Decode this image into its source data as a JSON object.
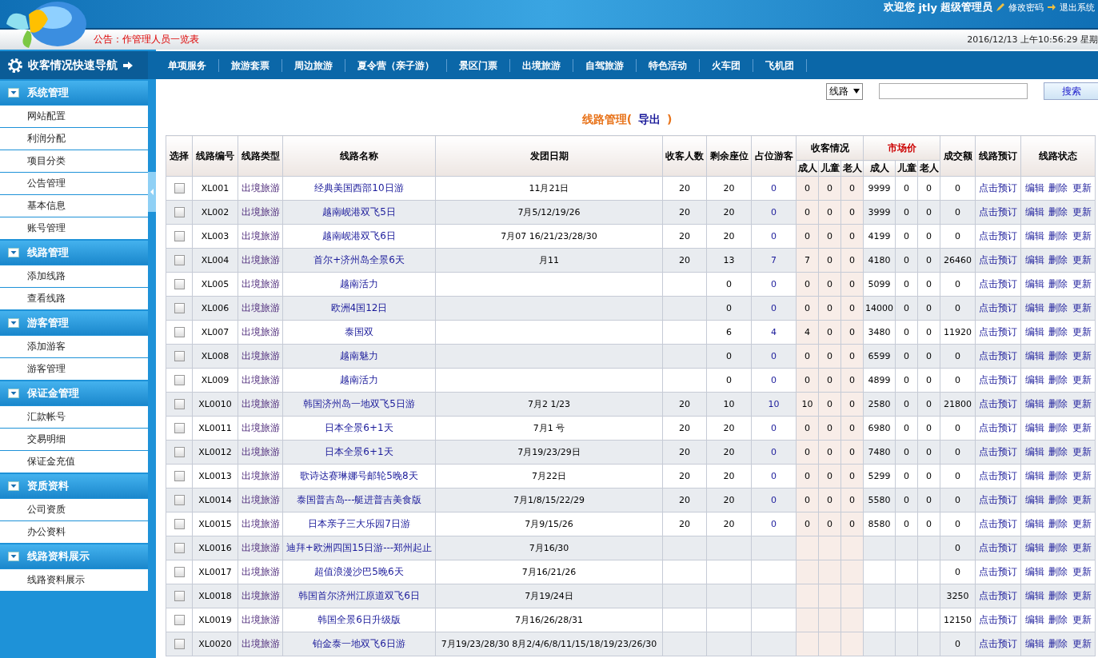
{
  "header": {
    "welcome": "欢迎您",
    "username": "jtly",
    "role": "超级管理员",
    "links": [
      "修改密码",
      "退出系统"
    ]
  },
  "notice": "公告：作管理人员一览表",
  "datetime": "2016/12/13 上午10:56:29 星期",
  "sidebar": {
    "title": "收客情况快速导航",
    "groups": [
      {
        "title": "系统管理",
        "expanded": true,
        "items": [
          "网站配置",
          "利润分配",
          "项目分类",
          "公告管理",
          "基本信息",
          "账号管理"
        ]
      },
      {
        "title": "线路管理",
        "expanded": true,
        "items": [
          "添加线路",
          "查看线路"
        ]
      },
      {
        "title": "游客管理",
        "expanded": true,
        "items": [
          "添加游客",
          "游客管理"
        ]
      },
      {
        "title": "保证金管理",
        "expanded": true,
        "items": [
          "汇款帐号",
          "交易明细",
          "保证金充值"
        ]
      },
      {
        "title": "资质资料",
        "expanded": true,
        "items": [
          "公司资质",
          "办公资料"
        ]
      },
      {
        "title": "线路资料展示",
        "expanded": true,
        "items": [
          "线路资料展示"
        ]
      }
    ]
  },
  "nav_tabs": [
    "单项服务",
    "旅游套票",
    "周边旅游",
    "夏令营（亲子游）",
    "景区门票",
    "出境旅游",
    "自驾旅游",
    "特色活动",
    "火车团",
    "飞机团"
  ],
  "search": {
    "filter": "线路",
    "button": "搜索"
  },
  "heading": {
    "title": "线路管理(",
    "link": "导出",
    "close": ")"
  },
  "table": {
    "columns": [
      {
        "label": "选择"
      },
      {
        "label": "线路编号"
      },
      {
        "label": "线路类型"
      },
      {
        "label": "线路名称"
      },
      {
        "label": "发团日期"
      },
      {
        "label": "收客人数"
      },
      {
        "label": "剩余座位"
      },
      {
        "label": "占位游客"
      },
      {
        "label": "收客情况",
        "highlight": false,
        "sub": [
          "成人",
          "儿童",
          "老人"
        ]
      },
      {
        "label": "市场价",
        "highlight": true,
        "sub": [
          "成人",
          "儿童",
          "老人"
        ]
      },
      {
        "label": "成交额"
      },
      {
        "label": "线路预订"
      },
      {
        "label": "线路状态"
      }
    ],
    "rows": [
      {
        "selected": false,
        "id": "XL001",
        "type": "出境旅游",
        "name": "经典美国西部10日游",
        "date": "11月21日",
        "booked": "20",
        "remaining": "20",
        "occupied": "0",
        "guests": [
          "0",
          "0",
          "0"
        ],
        "prices": [
          "9999",
          "0",
          "0"
        ],
        "amount": "0",
        "book": "点击预订",
        "actions": [
          "编辑",
          "删除",
          "更新"
        ]
      },
      {
        "selected": false,
        "id": "XL002",
        "type": "出境旅游",
        "name": "越南岘港双飞5日",
        "date": "7月5/12/19/26",
        "booked": "20",
        "remaining": "20",
        "occupied": "0",
        "guests": [
          "0",
          "0",
          "0"
        ],
        "prices": [
          "3999",
          "0",
          "0"
        ],
        "amount": "0",
        "book": "点击预订",
        "actions": [
          "编辑",
          "删除",
          "更新"
        ]
      },
      {
        "selected": false,
        "id": "XL003",
        "type": "出境旅游",
        "name": "越南岘港双飞6日",
        "date": "7月07 16/21/23/28/30",
        "booked": "20",
        "remaining": "20",
        "occupied": "0",
        "guests": [
          "0",
          "0",
          "0"
        ],
        "prices": [
          "4199",
          "0",
          "0"
        ],
        "amount": "0",
        "book": "点击预订",
        "actions": [
          "编辑",
          "删除",
          "更新"
        ]
      },
      {
        "selected": false,
        "id": "XL004",
        "type": "出境旅游",
        "name": "首尔+济州岛全景6天",
        "date": "月11",
        "booked": "20",
        "remaining": "13",
        "occupied": "7",
        "guests": [
          "7",
          "0",
          "0"
        ],
        "prices": [
          "4180",
          "0",
          "0"
        ],
        "amount": "26460",
        "book": "点击预订",
        "actions": [
          "编辑",
          "删除",
          "更新"
        ]
      },
      {
        "selected": false,
        "id": "XL005",
        "type": "出境旅游",
        "name": "越南活力",
        "remaining": "0",
        "occupied": "0",
        "guests": [
          "0",
          "0",
          "0"
        ],
        "prices": [
          "5099",
          "0",
          "0"
        ],
        "amount": "0",
        "book": "点击预订",
        "actions": [
          "编辑",
          "删除",
          "更新"
        ]
      },
      {
        "selected": false,
        "id": "XL006",
        "type": "出境旅游",
        "name": "欧洲4国12日",
        "remaining": "0",
        "occupied": "0",
        "guests": [
          "0",
          "0",
          "0"
        ],
        "prices": [
          "14000",
          "0",
          "0"
        ],
        "amount": "0",
        "book": "点击预订",
        "actions": [
          "编辑",
          "删除",
          "更新"
        ]
      },
      {
        "selected": false,
        "id": "XL007",
        "type": "出境旅游",
        "name": "泰国双",
        "remaining": "6",
        "occupied": "4",
        "guests": [
          "4",
          "0",
          "0"
        ],
        "prices": [
          "3480",
          "0",
          "0"
        ],
        "amount": "11920",
        "book": "点击预订",
        "actions": [
          "编辑",
          "删除",
          "更新"
        ]
      },
      {
        "selected": false,
        "id": "XL008",
        "type": "出境旅游",
        "name": "越南魅力",
        "remaining": "0",
        "occupied": "0",
        "guests": [
          "0",
          "0",
          "0"
        ],
        "prices": [
          "6599",
          "0",
          "0"
        ],
        "amount": "0",
        "book": "点击预订",
        "actions": [
          "编辑",
          "删除",
          "更新"
        ]
      },
      {
        "selected": false,
        "id": "XL009",
        "type": "出境旅游",
        "name": "越南活力",
        "remaining": "0",
        "occupied": "0",
        "guests": [
          "0",
          "0",
          "0"
        ],
        "prices": [
          "4899",
          "0",
          "0"
        ],
        "amount": "0",
        "book": "点击预订",
        "actions": [
          "编辑",
          "删除",
          "更新"
        ]
      },
      {
        "selected": false,
        "id": "XL0010",
        "type": "出境旅游",
        "name": "韩国济州岛一地双飞5日游",
        "date": "7月2 1/23",
        "booked": "20",
        "remaining": "10",
        "occupied": "10",
        "guests": [
          "10",
          "0",
          "0"
        ],
        "prices": [
          "2580",
          "0",
          "0"
        ],
        "amount": "21800",
        "book": "点击预订",
        "actions": [
          "编辑",
          "删除",
          "更新"
        ]
      },
      {
        "selected": false,
        "id": "XL0011",
        "type": "出境旅游",
        "name": "日本全景6+1天",
        "date": "7月1 号",
        "booked": "20",
        "remaining": "20",
        "occupied": "0",
        "guests": [
          "0",
          "0",
          "0"
        ],
        "prices": [
          "6980",
          "0",
          "0"
        ],
        "amount": "0",
        "book": "点击预订",
        "actions": [
          "编辑",
          "删除",
          "更新"
        ]
      },
      {
        "selected": false,
        "id": "XL0012",
        "type": "出境旅游",
        "name": "日本全景6+1天",
        "date": "7月19/23/29日",
        "booked": "20",
        "remaining": "20",
        "occupied": "0",
        "guests": [
          "0",
          "0",
          "0"
        ],
        "prices": [
          "7480",
          "0",
          "0"
        ],
        "amount": "0",
        "book": "点击预订",
        "actions": [
          "编辑",
          "删除",
          "更新"
        ]
      },
      {
        "selected": false,
        "id": "XL0013",
        "type": "出境旅游",
        "name": "歌诗达赛琳娜号邮轮5晚8天",
        "date": "7月22日",
        "booked": "20",
        "remaining": "20",
        "occupied": "0",
        "guests": [
          "0",
          "0",
          "0"
        ],
        "prices": [
          "5299",
          "0",
          "0"
        ],
        "amount": "0",
        "book": "点击预订",
        "actions": [
          "编辑",
          "删除",
          "更新"
        ]
      },
      {
        "selected": false,
        "id": "XL0014",
        "type": "出境旅游",
        "name": "泰国普吉岛---艇进普吉美食版",
        "date": "7月1/8/15/22/29",
        "booked": "20",
        "remaining": "20",
        "occupied": "0",
        "guests": [
          "0",
          "0",
          "0"
        ],
        "prices": [
          "5580",
          "0",
          "0"
        ],
        "amount": "0",
        "book": "点击预订",
        "actions": [
          "编辑",
          "删除",
          "更新"
        ]
      },
      {
        "selected": false,
        "id": "XL0015",
        "type": "出境旅游",
        "name": "日本亲子三大乐园7日游",
        "date": "7月9/15/26",
        "booked": "20",
        "remaining": "20",
        "occupied": "0",
        "guests": [
          "0",
          "0",
          "0"
        ],
        "prices": [
          "8580",
          "0",
          "0"
        ],
        "amount": "0",
        "book": "点击预订",
        "actions": [
          "编辑",
          "删除",
          "更新"
        ]
      },
      {
        "selected": false,
        "id": "XL0016",
        "type": "出境旅游",
        "name": "迪拜+欧洲四国15日游---郑州起止",
        "date": "7月16/30",
        "amount": "0",
        "book": "点击预订",
        "actions": [
          "编辑",
          "删除",
          "更新"
        ]
      },
      {
        "selected": false,
        "id": "XL0017",
        "type": "出境旅游",
        "name": "超值浪漫沙巴5晚6天",
        "date": "7月16/21/26",
        "amount": "0",
        "book": "点击预订",
        "actions": [
          "编辑",
          "删除",
          "更新"
        ]
      },
      {
        "selected": false,
        "id": "XL0018",
        "type": "出境旅游",
        "name": "韩国首尔济州江原道双飞6日",
        "date": "7月19/24日",
        "amount": "3250",
        "book": "点击预订",
        "actions": [
          "编辑",
          "删除",
          "更新"
        ]
      },
      {
        "selected": false,
        "id": "XL0019",
        "type": "出境旅游",
        "name": "韩国全景6日升级版",
        "date": "7月16/26/28/31",
        "amount": "12150",
        "book": "点击预订",
        "actions": [
          "编辑",
          "删除",
          "更新"
        ]
      },
      {
        "selected": false,
        "id": "XL0020",
        "type": "出境旅游",
        "name": "铂金泰一地双飞6日游",
        "date": "7月19/23/28/30 8月2/4/6/8/11/15/18/19/23/26/30",
        "amount": "0",
        "book": "点击预订",
        "actions": [
          "编辑",
          "删除",
          "更新"
        ]
      }
    ]
  }
}
